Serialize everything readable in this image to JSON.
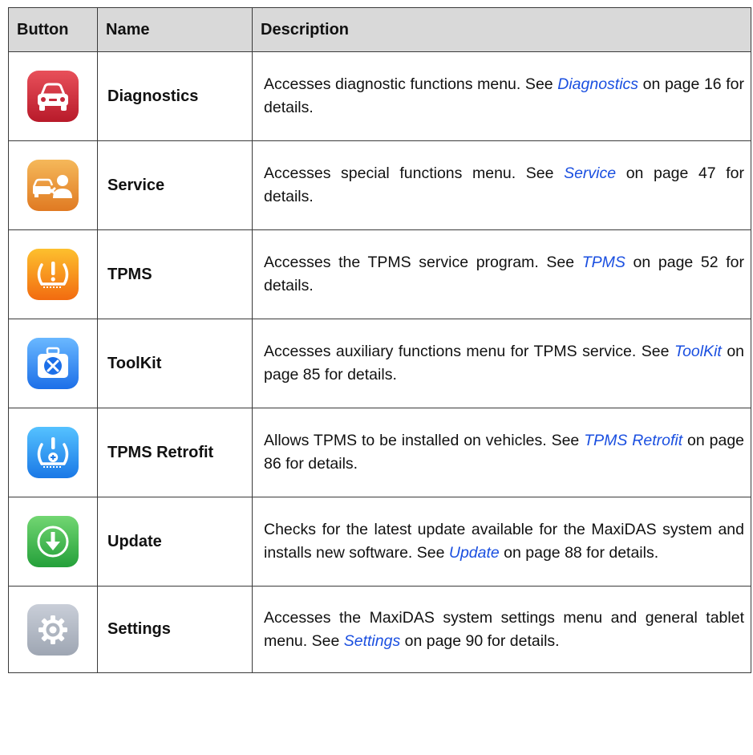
{
  "headers": {
    "button": "Button",
    "name": "Name",
    "description": "Description"
  },
  "rows": [
    {
      "icon": "car-diagnostics-icon",
      "name": "Diagnostics",
      "desc_pre": "Accesses diagnostic functions menu. See ",
      "link": "Diagnostics",
      "desc_post": " on page 16 for details."
    },
    {
      "icon": "car-service-technician-icon",
      "name": "Service",
      "desc_pre": "Accesses special functions menu. See ",
      "link": "Service",
      "desc_post": " on page 47 for details."
    },
    {
      "icon": "tire-pressure-warning-icon",
      "name": "TPMS",
      "desc_pre": "Accesses the TPMS service program. See ",
      "link": "TPMS",
      "desc_post": " on page 52 for details."
    },
    {
      "icon": "toolbox-icon",
      "name": "ToolKit",
      "desc_pre": "Accesses auxiliary functions menu for TPMS service. See ",
      "link": "ToolKit",
      "desc_post": " on page 85 for details."
    },
    {
      "icon": "tire-sensor-retrofit-icon",
      "name": "TPMS Retrofit",
      "desc_pre": "Allows TPMS to be installed on vehicles. See ",
      "link": "TPMS Retrofit",
      "desc_post": " on page 86 for details."
    },
    {
      "icon": "download-arrow-icon",
      "name": "Update",
      "desc_pre": "Checks for the latest update available for the MaxiDAS system and installs new software. See ",
      "link": "Update",
      "desc_post": " on page 88 for details."
    },
    {
      "icon": "gear-icon",
      "name": "Settings",
      "desc_pre": "Accesses the MaxiDAS system settings menu and general tablet menu. See ",
      "link": "Settings",
      "desc_post": " on page 90 for details."
    }
  ]
}
